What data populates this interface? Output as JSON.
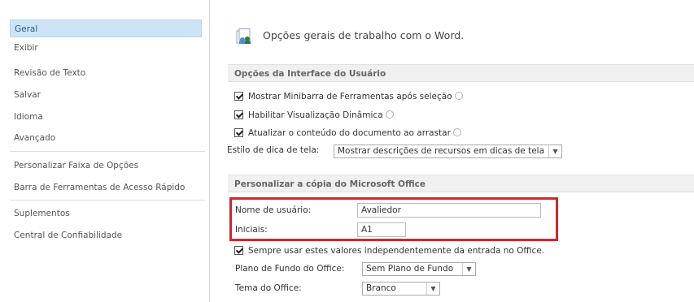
{
  "sidebar": {
    "items": [
      {
        "label": "Geral",
        "selected": true
      },
      {
        "label": "Exibir"
      },
      {
        "label": "Revisão de Texto"
      },
      {
        "label": "Salvar"
      },
      {
        "label": "Idioma"
      },
      {
        "label": "Avançado"
      },
      {
        "label": "Personalizar Faixa de Opções"
      },
      {
        "label": "Barra de Ferramentas de Acesso Rápido"
      },
      {
        "label": "Suplementos"
      },
      {
        "label": "Central de Confiabilidade"
      }
    ]
  },
  "header": {
    "title": "Opções gerais de trabalho com o Word."
  },
  "ui_options": {
    "section_title": "Opções da Interface do Usuário",
    "minibar": "Mostrar Minibarra de Ferramentas após seleção",
    "live_preview": "Habilitar Visualização Dinâmica",
    "update_drag": "Atualizar o conteúdo do documento ao arrastar",
    "screentip_label": "Estilo de dica de tela:",
    "screentip_value": "Mostrar descrições de recursos em dicas de tela"
  },
  "personalize": {
    "section_title": "Personalizar a cópia do Microsoft Office",
    "username_label": "Nome de usuário:",
    "username_value": "Avaliedor",
    "initials_label": "Iniciais:",
    "initials_value": "A1",
    "always_use": "Sempre usar estes valores independentemente da entrada no Office.",
    "background_label": "Plano de Fundo do Office:",
    "background_value": "Sem Plano de Fundo",
    "theme_label": "Tema do Office:",
    "theme_value": "Branco"
  },
  "colors": {
    "highlight": "#d9232d",
    "selected": "#cde4f7"
  }
}
